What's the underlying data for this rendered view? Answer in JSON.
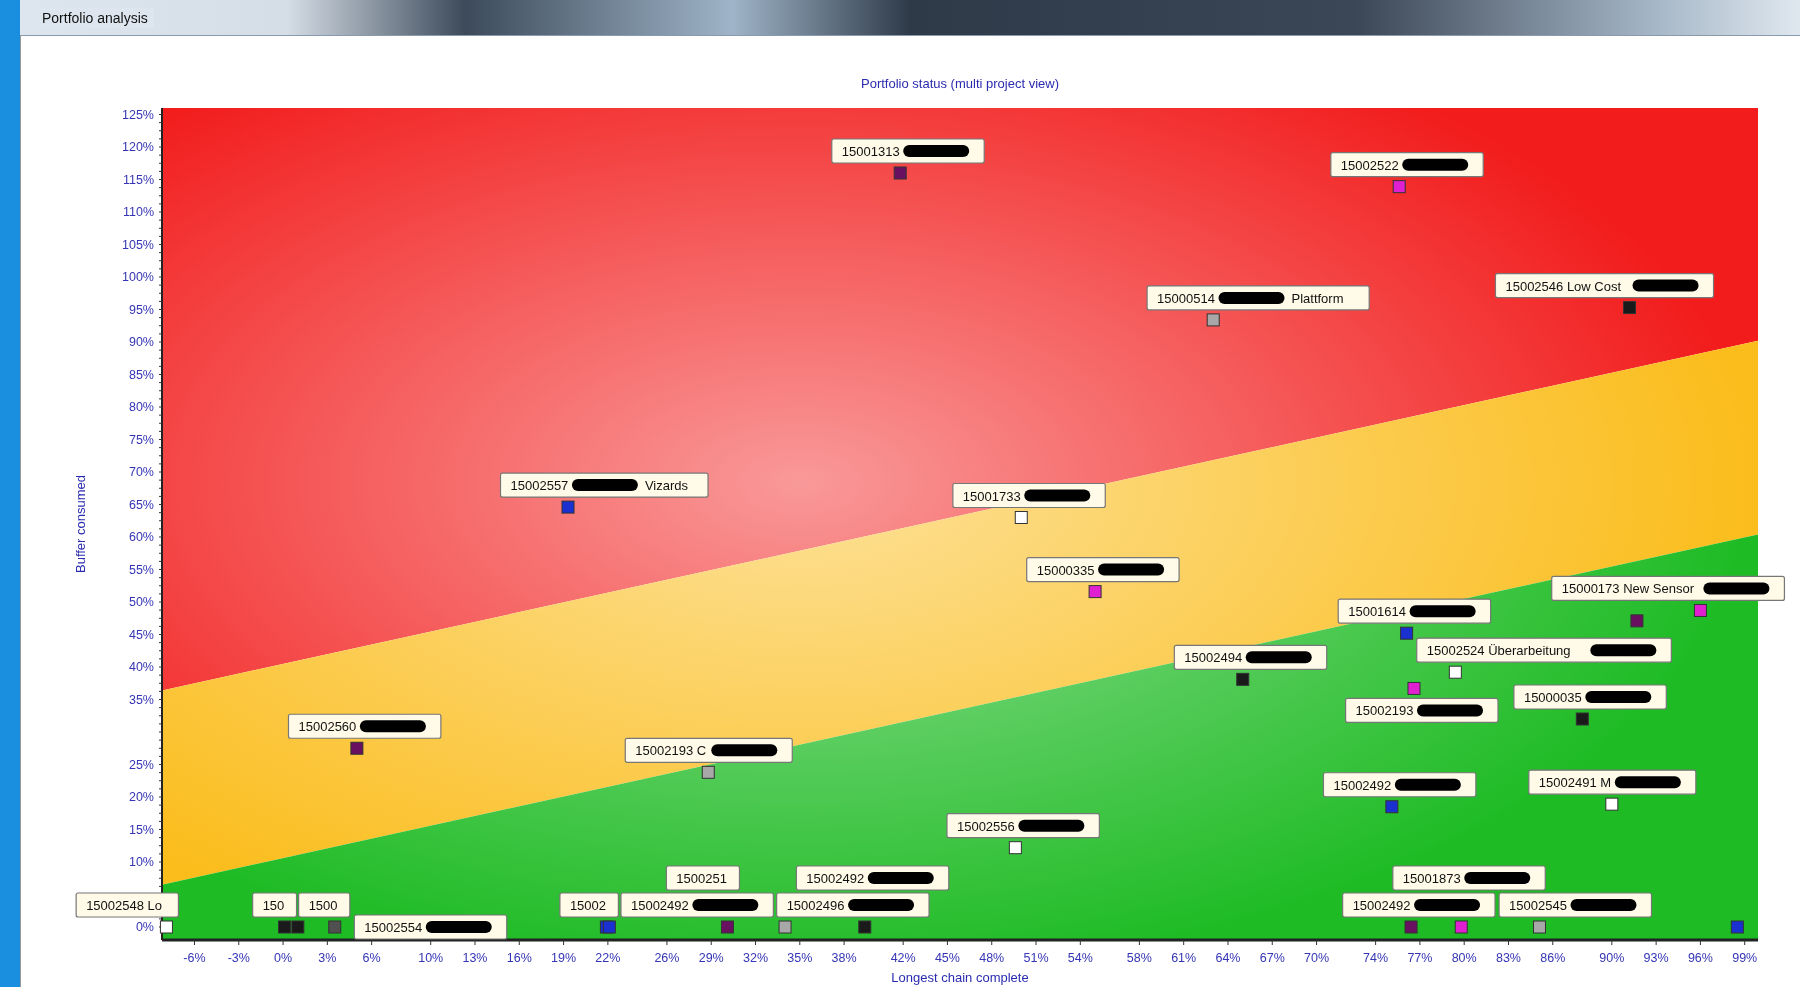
{
  "window": {
    "title": "Portfolio analysis"
  },
  "chart": {
    "chart_data": {
      "type": "scatter",
      "title": "Portfolio status (multi project view)",
      "xlabel": "Longest chain complete",
      "ylabel": "Buffer consumed",
      "xlim": [
        -8.2,
        99.9
      ],
      "ylim": [
        -2,
        126
      ],
      "xticks": [
        {
          "value": -6,
          "label": "-6%"
        },
        {
          "value": -3,
          "label": "-3%"
        },
        {
          "value": 0,
          "label": "0%"
        },
        {
          "value": 3,
          "label": "3%"
        },
        {
          "value": 6,
          "label": "6%"
        },
        {
          "value": 10,
          "label": "10%"
        },
        {
          "value": 13,
          "label": "13%"
        },
        {
          "value": 16,
          "label": "16%"
        },
        {
          "value": 19,
          "label": "19%"
        },
        {
          "value": 22,
          "label": "22%"
        },
        {
          "value": 26,
          "label": "26%"
        },
        {
          "value": 29,
          "label": "29%"
        },
        {
          "value": 32,
          "label": "32%"
        },
        {
          "value": 35,
          "label": "35%"
        },
        {
          "value": 38,
          "label": "38%"
        },
        {
          "value": 42,
          "label": "42%"
        },
        {
          "value": 45,
          "label": "45%"
        },
        {
          "value": 48,
          "label": "48%"
        },
        {
          "value": 51,
          "label": "51%"
        },
        {
          "value": 54,
          "label": "54%"
        },
        {
          "value": 58,
          "label": "58%"
        },
        {
          "value": 61,
          "label": "61%"
        },
        {
          "value": 64,
          "label": "64%"
        },
        {
          "value": 67,
          "label": "67%"
        },
        {
          "value": 70,
          "label": "70%"
        },
        {
          "value": 74,
          "label": "74%"
        },
        {
          "value": 77,
          "label": "77%"
        },
        {
          "value": 80,
          "label": "80%"
        },
        {
          "value": 83,
          "label": "83%"
        },
        {
          "value": 86,
          "label": "86%"
        },
        {
          "value": 90,
          "label": "90%"
        },
        {
          "value": 93,
          "label": "93%"
        },
        {
          "value": 96,
          "label": "96%"
        },
        {
          "value": 99,
          "label": "99%"
        }
      ],
      "yticks": [
        {
          "value": 0,
          "label": "0%"
        },
        {
          "value": 10,
          "label": "10%"
        },
        {
          "value": 15,
          "label": "15%"
        },
        {
          "value": 20,
          "label": "20%"
        },
        {
          "value": 25,
          "label": "25%"
        },
        {
          "value": 35,
          "label": "35%"
        },
        {
          "value": 40,
          "label": "40%"
        },
        {
          "value": 45,
          "label": "45%"
        },
        {
          "value": 50,
          "label": "50%"
        },
        {
          "value": 55,
          "label": "55%"
        },
        {
          "value": 60,
          "label": "60%"
        },
        {
          "value": 65,
          "label": "65%"
        },
        {
          "value": 70,
          "label": "70%"
        },
        {
          "value": 75,
          "label": "75%"
        },
        {
          "value": 80,
          "label": "80%"
        },
        {
          "value": 85,
          "label": "85%"
        },
        {
          "value": 90,
          "label": "90%"
        },
        {
          "value": 95,
          "label": "95%"
        },
        {
          "value": 100,
          "label": "100%"
        },
        {
          "value": 105,
          "label": "105%"
        },
        {
          "value": 110,
          "label": "110%"
        },
        {
          "value": 115,
          "label": "115%"
        },
        {
          "value": 120,
          "label": "120%"
        },
        {
          "value": 125,
          "label": "125%"
        }
      ],
      "series": [
        {
          "name": "15001313",
          "color": "#6a1060",
          "x": [
            41.8
          ],
          "values": [
            116
          ]
        },
        {
          "name": "15002522",
          "color": "#e020d0",
          "x": [
            75.6
          ],
          "values": [
            113.9
          ]
        },
        {
          "name": "15000514",
          "color": "#a8a8a8",
          "x": [
            63
          ],
          "values": [
            93.4
          ]
        },
        {
          "name": "15002546 Low Cost",
          "color": "#1a1a1a",
          "x": [
            91.2
          ],
          "values": [
            95.3
          ]
        },
        {
          "name": "15002557",
          "color": "#1a30d0",
          "x": [
            19.3
          ],
          "values": [
            64.6
          ]
        },
        {
          "name": "15001733",
          "color": "#ffffff",
          "x": [
            50
          ],
          "values": [
            63
          ]
        },
        {
          "name": "15000335",
          "color": "#e020d0",
          "x": [
            55
          ],
          "values": [
            51.6
          ]
        },
        {
          "name": "15000173 New Sensor",
          "color": "#e020d0",
          "x": [
            96
          ],
          "values": [
            48.7
          ]
        },
        {
          "color": "#6a1060",
          "x": [
            91.7
          ],
          "values": [
            47.1
          ]
        },
        {
          "name": "15001614",
          "color": "#1a30d0",
          "x": [
            76.1
          ],
          "values": [
            45.2
          ]
        },
        {
          "name": "15002524 Überarbeitung",
          "color": "#ffffff",
          "x": [
            79.4
          ],
          "values": [
            39.2
          ]
        },
        {
          "name": "15002494",
          "color": "#1a1a1a",
          "x": [
            65
          ],
          "values": [
            38.1
          ]
        },
        {
          "name": "15002193",
          "color": "#e020d0",
          "x": [
            76.6
          ],
          "values": [
            36.7
          ]
        },
        {
          "name": "15000035",
          "color": "#1a1a1a",
          "x": [
            88
          ],
          "values": [
            32
          ]
        },
        {
          "name": "15002560",
          "color": "#6a1060",
          "x": [
            5
          ],
          "values": [
            27.5
          ]
        },
        {
          "name": "15002193 C",
          "color": "#a8a8a8",
          "x": [
            28.8
          ],
          "values": [
            23.8
          ]
        },
        {
          "name": "15002492",
          "color": "#1a30d0",
          "x": [
            75.1
          ],
          "values": [
            18.5
          ]
        },
        {
          "name": "15002491 M",
          "color": "#ffffff",
          "x": [
            90
          ],
          "values": [
            18.9
          ]
        },
        {
          "name": "15002556",
          "color": "#ffffff",
          "x": [
            49.6
          ],
          "values": [
            12.2
          ]
        },
        {
          "name": "15002548 Lo",
          "color": "#ffffff",
          "x": [
            -7.9
          ],
          "values": [
            0
          ]
        },
        {
          "name": "150",
          "color": "#1a1a1a",
          "x": [
            0.1
          ],
          "values": [
            0
          ]
        },
        {
          "name": "1500",
          "color": "#1a1a1a",
          "x": [
            1
          ],
          "values": [
            0
          ]
        },
        {
          "name": "15002554",
          "color": "#505050",
          "x": [
            3.5
          ],
          "values": [
            0
          ]
        },
        {
          "name": "15002",
          "color": "#1a30d0",
          "x": [
            21.9
          ],
          "values": [
            0
          ]
        },
        {
          "name": "15002492",
          "color": "#1a30d0",
          "x": [
            22.1
          ],
          "values": [
            0
          ]
        },
        {
          "name": "1500251",
          "color": "#6a1060",
          "x": [
            30.1
          ],
          "values": [
            0
          ]
        },
        {
          "name": "15002496",
          "color": "#a8a8a8",
          "x": [
            34
          ],
          "values": [
            0
          ]
        },
        {
          "name": "15002492",
          "color": "#1a1a1a",
          "x": [
            39.4
          ],
          "values": [
            0
          ]
        },
        {
          "name": "15002492",
          "color": "#6a1060",
          "x": [
            76.4
          ],
          "values": [
            0
          ]
        },
        {
          "name": "15001873",
          "color": "#e020d0",
          "x": [
            79.8
          ],
          "values": [
            0
          ]
        },
        {
          "name": "15002545",
          "color": "#a8a8a8",
          "x": [
            85.1
          ],
          "values": [
            0
          ]
        },
        {
          "color": "#1a30d0",
          "x": [
            98.5
          ],
          "values": [
            0
          ]
        }
      ]
    },
    "zones": [
      {
        "color": "#f21c1c"
      },
      {
        "color": "#fbbd1c"
      },
      {
        "color": "#1ebb24"
      }
    ],
    "point_labels": [
      {
        "redacted": true
      },
      {
        "redacted": true
      },
      {
        "redacted": true,
        "label_end": "Plattform"
      },
      {
        "redacted": true
      },
      {
        "redacted": true,
        "label_end": "Vizards"
      },
      {
        "redacted": true
      },
      {
        "redacted": true
      },
      {
        "redacted": true
      },
      {
        "redacted": true
      },
      {
        "redacted": true
      },
      {
        "redacted": true
      },
      {
        "redacted": true
      },
      {
        "redacted": true
      },
      {
        "redacted": true
      },
      {
        "redacted": true
      },
      {
        "redacted": true
      },
      {
        "redacted": true
      },
      {
        "redacted": true
      },
      {
        "redacted": false
      },
      {
        "redacted": false
      },
      {
        "redacted": false
      },
      {
        "redacted": true
      },
      {
        "redacted": false
      },
      {
        "redacted": true
      },
      {
        "redacted": false
      },
      {
        "redacted": true
      },
      {
        "redacted": true
      },
      {
        "redacted": true
      },
      {
        "redacted": true
      },
      {
        "redacted": true
      }
    ]
  }
}
